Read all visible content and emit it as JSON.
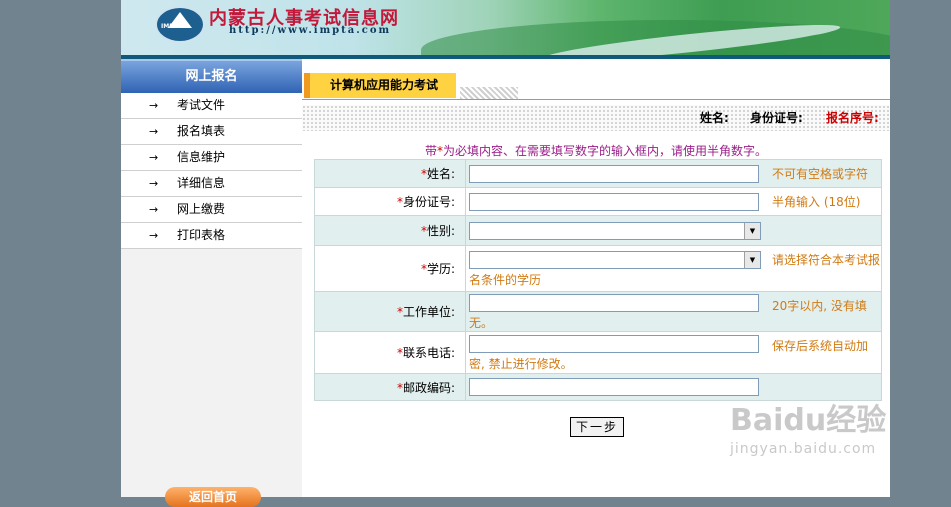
{
  "banner": {
    "logo_text": "IMPTA",
    "title": "内蒙古人事考试信息网",
    "url": "http://www.impta.com"
  },
  "sidebar": {
    "header": "网上报名",
    "arrow": "→",
    "items": [
      {
        "label": "考试文件"
      },
      {
        "label": "报名填表"
      },
      {
        "label": "信息维护"
      },
      {
        "label": "详细信息"
      },
      {
        "label": "网上缴费"
      },
      {
        "label": "打印表格"
      }
    ],
    "home_button": "返回首页"
  },
  "main": {
    "tab_title": "计算机应用能力考试",
    "info_labels": {
      "name": "姓名:",
      "id": "身份证号:",
      "reg_no": "报名序号:"
    },
    "notice_prefix": "带",
    "notice_star": "*",
    "notice_rest": "为必填内容、在需要填写数字的输入框内，请使用半角数字。",
    "required_mark": "*",
    "fields": [
      {
        "label": "姓名:",
        "type": "text",
        "value": "",
        "hint": "不可有空格或字符"
      },
      {
        "label": "身份证号:",
        "type": "text",
        "value": "",
        "hint": "半角输入 (18位)"
      },
      {
        "label": "性别:",
        "type": "select",
        "value": "",
        "hint": ""
      },
      {
        "label": "学历:",
        "type": "select",
        "value": "",
        "hint_line1": "请选择符合本考试报",
        "hint_line2": "名条件的学历"
      },
      {
        "label": "工作单位:",
        "type": "text",
        "value": "",
        "hint_line1": "20字以内, 没有填",
        "hint_line2": "无。"
      },
      {
        "label": "联系电话:",
        "type": "text",
        "value": "",
        "hint_line1": "保存后系统自动加",
        "hint_line2": "密, 禁止进行修改。"
      },
      {
        "label": "邮政编码:",
        "type": "text",
        "value": "",
        "hint": ""
      }
    ],
    "next_button": "下一步"
  },
  "watermark": {
    "main": "Baidu经验",
    "sub": "jingyan.baidu.com"
  },
  "colors": {
    "page_bg": "#728390",
    "sidebar_header": "#2f63b4",
    "tab_bg": "#ffd242",
    "hint": "#d07a12",
    "notice": "#9b1d8a",
    "required": "#cc0000"
  }
}
